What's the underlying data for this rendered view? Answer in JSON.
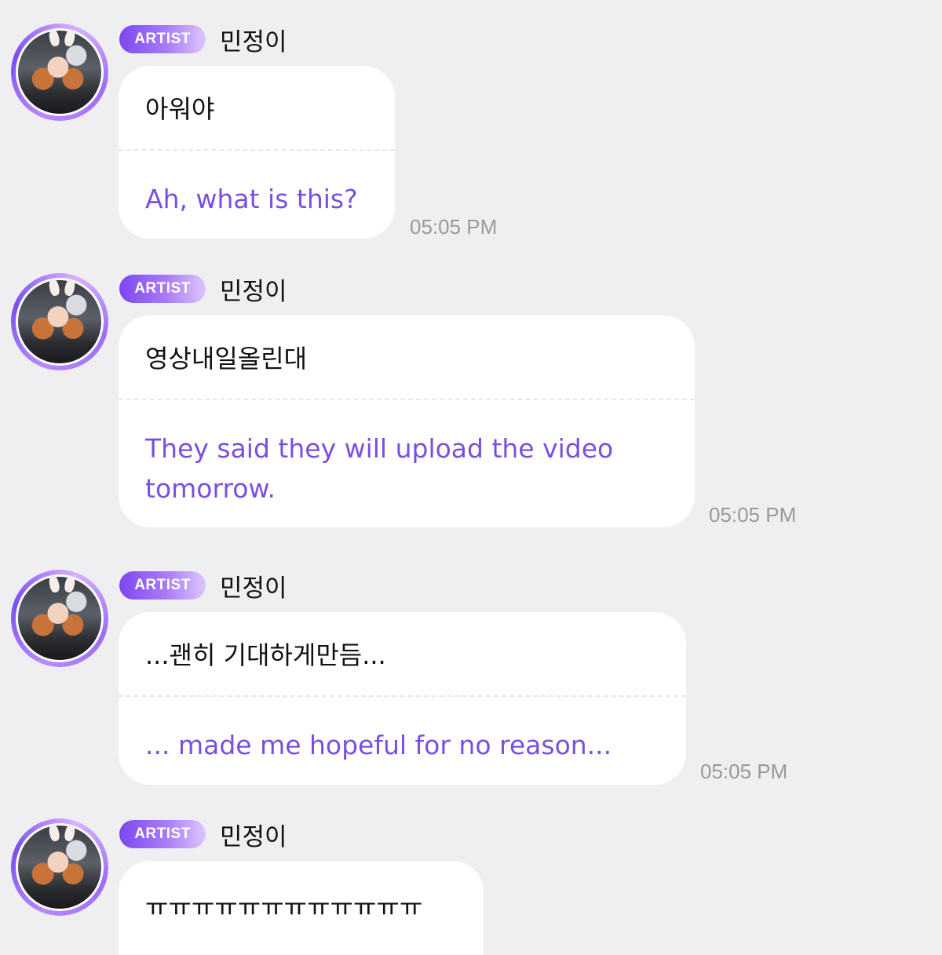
{
  "colors": {
    "background": "#efeff1",
    "bubble": "#ffffff",
    "badge_start": "#7d47f0",
    "badge_end": "#ddc6ff",
    "translation_text": "#7a4fe0",
    "timestamp": "#9a9a9a"
  },
  "messages": [
    {
      "badge": "ARTIST",
      "sender": "민정이",
      "original": "아워야",
      "translation": "Ah, what is this?",
      "time": "05:05 PM"
    },
    {
      "badge": "ARTIST",
      "sender": "민정이",
      "original": "영상내일올린대",
      "translation": "They said they will upload the video tomorrow.",
      "time": "05:05 PM"
    },
    {
      "badge": "ARTIST",
      "sender": "민정이",
      "original": "...괜히 기대하게만듬...",
      "translation": "... made me hopeful for no reason...",
      "time": "05:05 PM"
    },
    {
      "badge": "ARTIST",
      "sender": "민정이",
      "original": "ㅠㅠㅠㅠㅠㅠㅠㅠㅠㅠㅠㅠ"
    }
  ]
}
